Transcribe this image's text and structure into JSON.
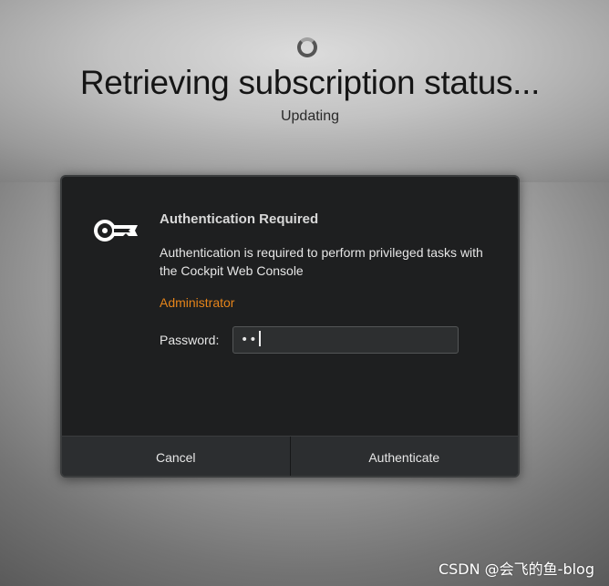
{
  "background": {
    "spinner_icon": "loading-spinner",
    "title": "Retrieving subscription status...",
    "subtitle": "Updating"
  },
  "dialog": {
    "icon": "key-icon",
    "title": "Authentication Required",
    "message": "Authentication is required to perform privileged tasks with the Cockpit Web Console",
    "user": "Administrator",
    "password_label": "Password:",
    "password_masked": "••",
    "buttons": {
      "cancel": "Cancel",
      "authenticate": "Authenticate"
    }
  },
  "watermark": "CSDN @会飞的鱼-blog",
  "colors": {
    "dialog_bg": "#1e1f20",
    "accent_orange": "#e5841a",
    "button_bg": "#2c2e30"
  }
}
